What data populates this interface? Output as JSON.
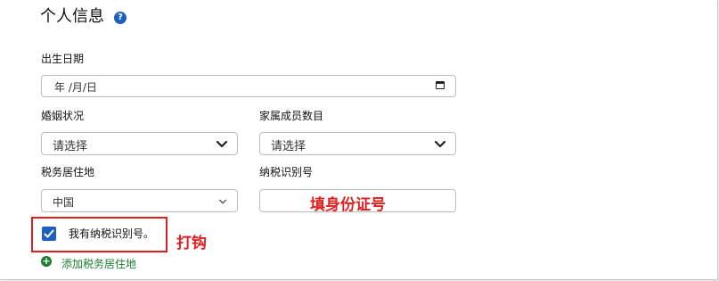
{
  "section": {
    "title": "个人信息",
    "help_icon": "question-icon",
    "help_glyph": "?"
  },
  "birth_date": {
    "label": "出生日期",
    "placeholder": "年 /月/日",
    "icon": "calendar-icon"
  },
  "marital_status": {
    "label": "婚姻状况",
    "value": "请选择"
  },
  "family_members": {
    "label": "家属成员数目",
    "value": "请选择"
  },
  "tax_residence": {
    "label": "税务居住地",
    "value": "中国"
  },
  "tax_id": {
    "label": "纳税识别号",
    "value": "填身份证号"
  },
  "has_tax_id": {
    "label": "我有纳税识别号。",
    "checked": true
  },
  "annotations": {
    "check_note": "打钩"
  },
  "add_residence": {
    "label": "添加税务居住地",
    "icon": "plus-circle-icon",
    "glyph": "+"
  },
  "colors": {
    "accent": "#1f5fbf",
    "link_green": "#1a7f2e",
    "annotation_red": "#e02020"
  }
}
